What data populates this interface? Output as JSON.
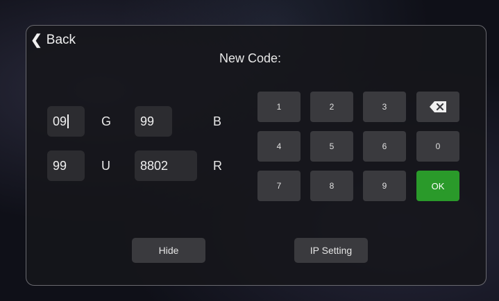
{
  "back": {
    "label": "Back"
  },
  "title": "New Code:",
  "fields": {
    "field1": "09",
    "field2": "99",
    "field3": "99",
    "field4": "8802"
  },
  "labels": {
    "g": "G",
    "b": "B",
    "u": "U",
    "r": "R"
  },
  "keypad": {
    "k1": "1",
    "k2": "2",
    "k3": "3",
    "k4": "4",
    "k5": "5",
    "k6": "6",
    "k0": "0",
    "k7": "7",
    "k8": "8",
    "k9": "9",
    "ok": "OK",
    "backspace_icon": "backspace-icon"
  },
  "buttons": {
    "hide": "Hide",
    "ip_setting": "IP Setting"
  },
  "colors": {
    "ok_key": "#2a9a2a",
    "panel_border": "#6a6a70",
    "key_bg": "#3a3a3e"
  }
}
